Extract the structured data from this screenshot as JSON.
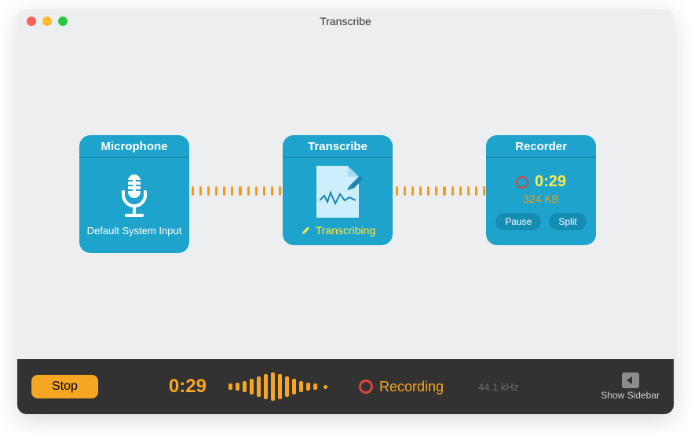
{
  "window": {
    "title": "Transcribe"
  },
  "nodes": {
    "mic": {
      "title": "Microphone",
      "subtitle": "Default System Input"
    },
    "transcribe": {
      "title": "Transcribe",
      "status": "Transcribing"
    },
    "recorder": {
      "title": "Recorder",
      "time": "0:29",
      "size": "324 KB",
      "pause_label": "Pause",
      "split_label": "Split"
    }
  },
  "bottombar": {
    "stop_label": "Stop",
    "time": "0:29",
    "status": "Recording",
    "sample_rate": "44.1 kHz",
    "sidebar_label": "Show Sidebar",
    "waveform_bars": [
      8,
      10,
      14,
      20,
      26,
      32,
      36,
      32,
      26,
      20,
      14,
      10,
      8
    ]
  },
  "colors": {
    "accent": "#f5a623",
    "node": "#1ea3cc",
    "rec": "#d9463a"
  }
}
